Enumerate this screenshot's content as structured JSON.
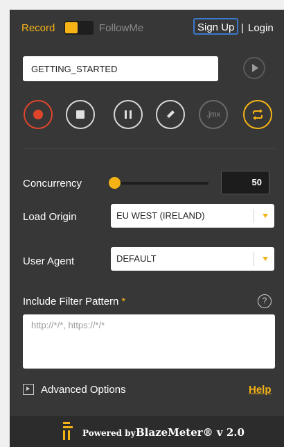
{
  "header": {
    "record_label": "Record",
    "followme_label": "FollowMe",
    "signup_label": "Sign Up",
    "separator": "|",
    "login_label": "Login"
  },
  "test": {
    "name_value": "GETTING_STARTED"
  },
  "actions": {
    "jmx_label": ".jmx"
  },
  "settings": {
    "concurrency_label": "Concurrency",
    "concurrency_value": "50",
    "concurrency_slider_level": 0.0,
    "load_origin_label": "Load Origin",
    "load_origin_value": "EU WEST (IRELAND)",
    "user_agent_label": "User Agent",
    "user_agent_value": "DEFAULT",
    "filter_label": "Include Filter Pattern",
    "filter_required_mark": "*",
    "filter_help_icon": "?",
    "filter_placeholder": "http://*/*, https://*/*"
  },
  "footer_links": {
    "advanced_label": "Advanced Options",
    "help_label": "Help"
  },
  "footer": {
    "powered_label": "Powered by",
    "brand_label": "BlazeMeter® v 2.0"
  },
  "colors": {
    "accent": "#f5b316",
    "record_red": "#e0452c",
    "panel_bg": "#373737",
    "signup_border": "#3b78c9"
  }
}
